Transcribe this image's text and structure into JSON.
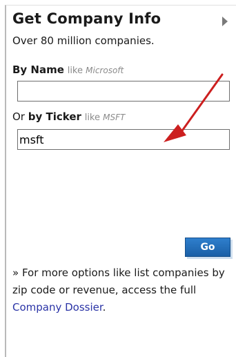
{
  "widget": {
    "title": "Get Company Info",
    "subtitle": "Over 80 million companies.",
    "expand_icon": "play-right-icon"
  },
  "by_name": {
    "label_bold": "By Name",
    "hint_prefix": "like",
    "hint_example": "Microsoft",
    "value": ""
  },
  "by_ticker": {
    "label_prefix": "Or",
    "label_bold": "by Ticker",
    "hint_prefix": "like",
    "hint_example": "MSFT",
    "value": "msft"
  },
  "go_button": {
    "label": "Go",
    "color": "#1f6db8"
  },
  "more_options": {
    "bullet": "»",
    "text": "For more options like list companies by zip code or revenue, access the full",
    "link_label": "Company Dossier",
    "suffix": "."
  },
  "annotation": {
    "arrow_color": "#cc1f1f"
  }
}
